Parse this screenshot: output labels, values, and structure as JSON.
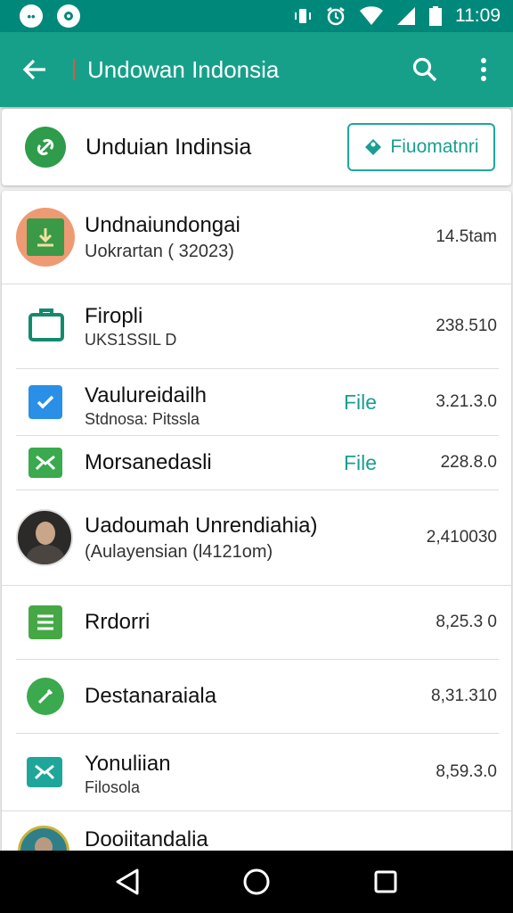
{
  "status": {
    "time": "11:09"
  },
  "appbar": {
    "title": "Undowan Indonsia"
  },
  "header": {
    "name": "Unduian Indinsia",
    "button": "Fiuomatnri"
  },
  "rows": [
    {
      "title": "Undnaiundongai",
      "subtitle": "Uokrartan ( 32023)",
      "size": "14.5tam"
    },
    {
      "title": "Firopli",
      "subtitle": "UKS1SSIL D",
      "size": "238.510"
    },
    {
      "title": "Vaulureidailh",
      "subtitle": "Stdnosa: Pitssla",
      "tag": "File",
      "size": "3.21.3.0"
    },
    {
      "title": "Morsanedasli",
      "tag": "File",
      "size": "228.8.0"
    },
    {
      "title": "Uadoumah Unrendiahia)",
      "subtitle": "(Aulayensian (l4121om)",
      "size": "2,410030"
    },
    {
      "title": "Rrdorri",
      "size": "8,25.3 0"
    },
    {
      "title": "Destanaraiala",
      "size": "8,31.310"
    },
    {
      "title": "Yonuliian",
      "subtitle": "Filosola",
      "size": "8,59.3.0"
    },
    {
      "title": "Dooiitandalia"
    }
  ],
  "colors": {
    "accent": "#16a08a",
    "status": "#00897b",
    "tag": "#1a9e90"
  }
}
